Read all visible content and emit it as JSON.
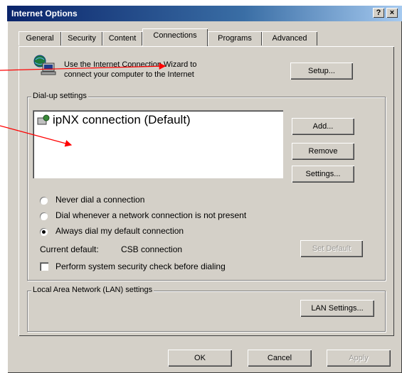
{
  "window": {
    "title": "Internet Options",
    "help_button": "?",
    "close_button": "×"
  },
  "tabs": [
    {
      "label": "General"
    },
    {
      "label": "Security"
    },
    {
      "label": "Content"
    },
    {
      "label": "Connections",
      "active": true
    },
    {
      "label": "Programs"
    },
    {
      "label": "Advanced"
    }
  ],
  "wizard": {
    "text_line1": "Use the Internet Connection Wizard to",
    "text_line2": "connect your computer to the Internet",
    "setup_button": "Setup..."
  },
  "dialup": {
    "group_label": "Dial-up settings",
    "connections": [
      "ipNX connection (Default)"
    ],
    "add_button": "Add...",
    "remove_button": "Remove",
    "settings_button": "Settings...",
    "options": [
      {
        "label": "Never dial a connection",
        "checked": false
      },
      {
        "label": "Dial whenever a network connection is not present",
        "checked": false
      },
      {
        "label": "Always dial my default connection",
        "checked": true
      }
    ],
    "current_default_label": "Current default:",
    "current_default_value": "CSB connection",
    "set_default_button": "Set Default",
    "security_check_label": "Perform system security check before dialing"
  },
  "lan": {
    "group_label": "Local Area Network (LAN) settings",
    "lan_settings_button": "LAN Settings..."
  },
  "footer": {
    "ok_button": "OK",
    "cancel_button": "Cancel",
    "apply_button": "Apply"
  },
  "colors": {
    "arrow": "#ff0000",
    "title_bar": "#0a246a"
  }
}
